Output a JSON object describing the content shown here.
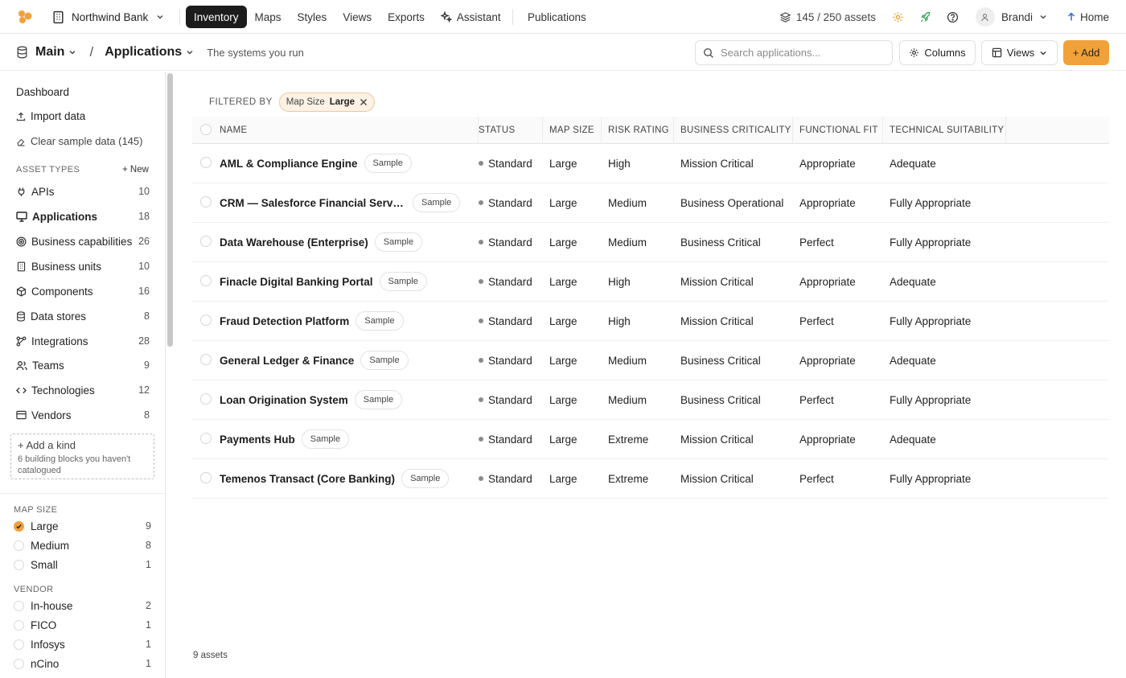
{
  "topbar": {
    "org_name": "Northwind Bank",
    "nav": [
      {
        "label": "Inventory",
        "active": true
      },
      {
        "label": "Maps"
      },
      {
        "label": "Styles"
      },
      {
        "label": "Views"
      },
      {
        "label": "Exports"
      },
      {
        "label": "Assistant",
        "icon": "sparkle-icon"
      }
    ],
    "publications_label": "Publications",
    "assets_count": "145 / 250 assets",
    "user_name": "Brandi",
    "home_label": "Home",
    "accent_color": "#f1a13a"
  },
  "subbar": {
    "workspace": "Main",
    "page": "Applications",
    "tagline": "The systems you run",
    "search_placeholder": "Search applications...",
    "columns_label": "Columns",
    "views_label": "Views",
    "add_label": "+ Add"
  },
  "sidebar": {
    "dashboard": "Dashboard",
    "import": "Import data",
    "clear": "Clear sample data (145)",
    "asset_types_title": "ASSET TYPES",
    "new_label": "+ New",
    "kinds": [
      {
        "label": "APIs",
        "count": "10",
        "icon": "plug-icon"
      },
      {
        "label": "Applications",
        "count": "18",
        "icon": "monitor-icon",
        "active": true
      },
      {
        "label": "Business capabilities",
        "count": "26",
        "icon": "target-icon"
      },
      {
        "label": "Business units",
        "count": "10",
        "icon": "building-icon"
      },
      {
        "label": "Components",
        "count": "16",
        "icon": "box-icon"
      },
      {
        "label": "Data stores",
        "count": "8",
        "icon": "database-icon"
      },
      {
        "label": "Integrations",
        "count": "28",
        "icon": "network-icon"
      },
      {
        "label": "Teams",
        "count": "9",
        "icon": "users-icon"
      },
      {
        "label": "Technologies",
        "count": "12",
        "icon": "code-icon"
      },
      {
        "label": "Vendors",
        "count": "8",
        "icon": "card-icon"
      }
    ],
    "add_kind_title": "+ Add a kind",
    "add_kind_sub": "6 building blocks you haven't catalogued",
    "map_size_title": "MAP SIZE",
    "map_sizes": [
      {
        "label": "Large",
        "count": "9",
        "checked": true
      },
      {
        "label": "Medium",
        "count": "8",
        "checked": false
      },
      {
        "label": "Small",
        "count": "1",
        "checked": false
      }
    ],
    "vendor_title": "VENDOR",
    "vendors": [
      {
        "label": "In-house",
        "count": "2"
      },
      {
        "label": "FICO",
        "count": "1"
      },
      {
        "label": "Infosys",
        "count": "1"
      },
      {
        "label": "nCino",
        "count": "1"
      }
    ]
  },
  "filter": {
    "label": "FILTERED BY",
    "chip_key": "Map Size",
    "chip_value": "Large"
  },
  "table": {
    "columns": [
      "NAME",
      "STATUS",
      "MAP SIZE",
      "RISK RATING",
      "BUSINESS CRITICALITY",
      "FUNCTIONAL FIT",
      "TECHNICAL SUITABILITY"
    ],
    "sample_label": "Sample",
    "rows": [
      {
        "name": "AML & Compliance Engine",
        "status": "Standard",
        "map_size": "Large",
        "risk": "High",
        "criticality": "Mission Critical",
        "fit": "Appropriate",
        "suitability": "Adequate"
      },
      {
        "name": "CRM — Salesforce Financial Services Cloud",
        "status": "Standard",
        "map_size": "Large",
        "risk": "Medium",
        "criticality": "Business Operational",
        "fit": "Appropriate",
        "suitability": "Fully Appropriate"
      },
      {
        "name": "Data Warehouse (Enterprise)",
        "status": "Standard",
        "map_size": "Large",
        "risk": "Medium",
        "criticality": "Business Critical",
        "fit": "Perfect",
        "suitability": "Fully Appropriate"
      },
      {
        "name": "Finacle Digital Banking Portal",
        "status": "Standard",
        "map_size": "Large",
        "risk": "High",
        "criticality": "Mission Critical",
        "fit": "Appropriate",
        "suitability": "Adequate"
      },
      {
        "name": "Fraud Detection Platform",
        "status": "Standard",
        "map_size": "Large",
        "risk": "High",
        "criticality": "Mission Critical",
        "fit": "Perfect",
        "suitability": "Fully Appropriate"
      },
      {
        "name": "General Ledger & Finance",
        "status": "Standard",
        "map_size": "Large",
        "risk": "Medium",
        "criticality": "Business Critical",
        "fit": "Appropriate",
        "suitability": "Adequate"
      },
      {
        "name": "Loan Origination System",
        "status": "Standard",
        "map_size": "Large",
        "risk": "Medium",
        "criticality": "Business Critical",
        "fit": "Perfect",
        "suitability": "Fully Appropriate"
      },
      {
        "name": "Payments Hub",
        "status": "Standard",
        "map_size": "Large",
        "risk": "Extreme",
        "criticality": "Mission Critical",
        "fit": "Appropriate",
        "suitability": "Adequate"
      },
      {
        "name": "Temenos Transact (Core Banking)",
        "status": "Standard",
        "map_size": "Large",
        "risk": "Extreme",
        "criticality": "Mission Critical",
        "fit": "Perfect",
        "suitability": "Fully Appropriate"
      }
    ],
    "footer": "9 assets"
  }
}
